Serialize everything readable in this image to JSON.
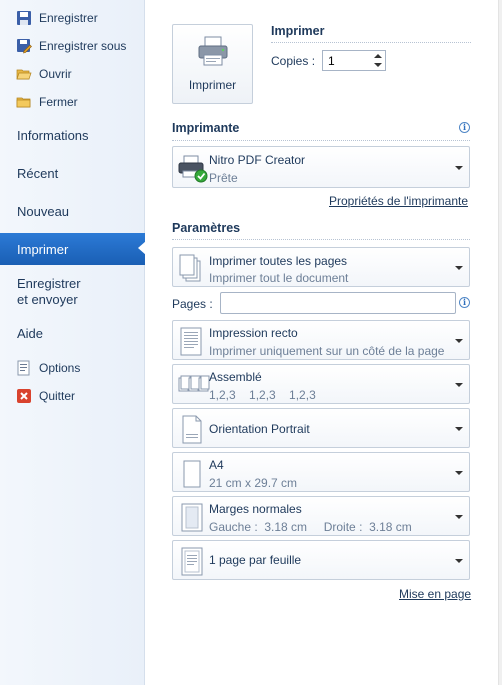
{
  "nav": {
    "commands_top": [
      {
        "label": "Enregistrer",
        "icon": "save-icon"
      },
      {
        "label": "Enregistrer sous",
        "icon": "save-as-icon"
      },
      {
        "label": "Ouvrir",
        "icon": "open-folder-icon"
      },
      {
        "label": "Fermer",
        "icon": "close-folder-icon"
      }
    ],
    "tabs": {
      "informations": "Informations",
      "recent": "Récent",
      "nouveau": "Nouveau",
      "imprimer": "Imprimer",
      "enregistrer_line1": "Enregistrer",
      "enregistrer_line2": "et envoyer",
      "aide": "Aide"
    },
    "commands_bottom": [
      {
        "label": "Options",
        "icon": "options-icon"
      },
      {
        "label": "Quitter",
        "icon": "exit-icon"
      }
    ],
    "active_color": "#1f67bf"
  },
  "print": {
    "title": "Imprimer",
    "button_label": "Imprimer",
    "copies_label": "Copies :",
    "copies_value": "1"
  },
  "printer": {
    "section_title": "Imprimante",
    "name": "Nitro PDF Creator",
    "status": "Prête",
    "properties_link": "Propriétés de l'imprimante"
  },
  "settings": {
    "section_title": "Paramètres",
    "pages_label": "Pages :",
    "pages_value": "",
    "items": [
      {
        "title": "Imprimer toutes les pages",
        "subtitle": "Imprimer tout le document",
        "icon": "pages-range-icon"
      },
      {
        "title": "Impression recto",
        "subtitle": "Imprimer uniquement sur un côté de la page",
        "icon": "one-sided-icon"
      },
      {
        "title": "Assemblé",
        "subtitle": "1,2,3    1,2,3    1,2,3",
        "icon": "collated-icon"
      },
      {
        "title": "Orientation Portrait",
        "subtitle": "",
        "icon": "portrait-icon"
      },
      {
        "title": "A4",
        "subtitle": "21 cm x 29.7 cm",
        "icon": "paper-size-icon"
      },
      {
        "title": "Marges normales",
        "subtitle": "Gauche :  3.18 cm     Droite :  3.18 cm",
        "icon": "margins-icon"
      },
      {
        "title": "1 page par feuille",
        "subtitle": "",
        "icon": "pages-per-sheet-icon"
      }
    ],
    "page_setup_link": "Mise en page"
  }
}
